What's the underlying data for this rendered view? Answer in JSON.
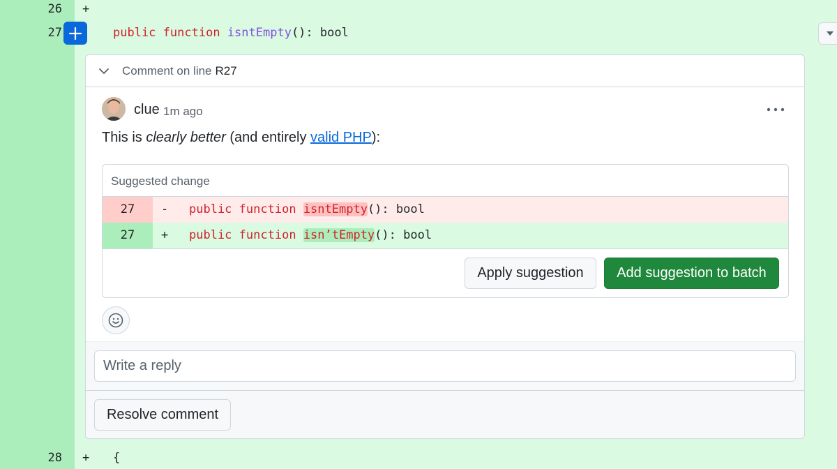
{
  "diff": {
    "line_26": {
      "number": "26",
      "marker": "+"
    },
    "line_27": {
      "number": "27",
      "marker": "+",
      "kw1": "public",
      "kw2": "function",
      "fn": "isntEmpty",
      "rest": "(): bool"
    },
    "line_28": {
      "number": "28",
      "marker": "+",
      "code": "{"
    }
  },
  "comment_thread": {
    "header_prefix": "Comment on line",
    "line_ref": "R27",
    "author": "clue",
    "time": "1m ago",
    "body": {
      "part1": "This is ",
      "emphasis": "clearly better",
      "part2": " (and entirely ",
      "link": "valid PHP",
      "part3": "):"
    },
    "suggestion": {
      "title": "Suggested change",
      "removed": {
        "number": "27",
        "marker": "-",
        "kw1": "public",
        "kw2": "function",
        "fn": "isntEmpty",
        "rest": "(): bool"
      },
      "added": {
        "number": "27",
        "marker": "+",
        "kw1": "public",
        "kw2": "function",
        "fn": "isn’tEmpty",
        "rest": "(): bool"
      },
      "apply_label": "Apply suggestion",
      "batch_label": "Add suggestion to batch"
    },
    "reply_placeholder": "Write a reply",
    "resolve_label": "Resolve comment"
  },
  "icons": {
    "add_line": "plus-icon",
    "collapse": "chevron-down-icon",
    "more": "kebab-horizontal-icon",
    "reaction": "smiley-icon",
    "options": "triangle-down-icon"
  },
  "colors": {
    "primary_green": "#1f883d",
    "link_blue": "#0969da",
    "added_bg": "#dafbe1",
    "removed_bg": "#ffebe9"
  }
}
